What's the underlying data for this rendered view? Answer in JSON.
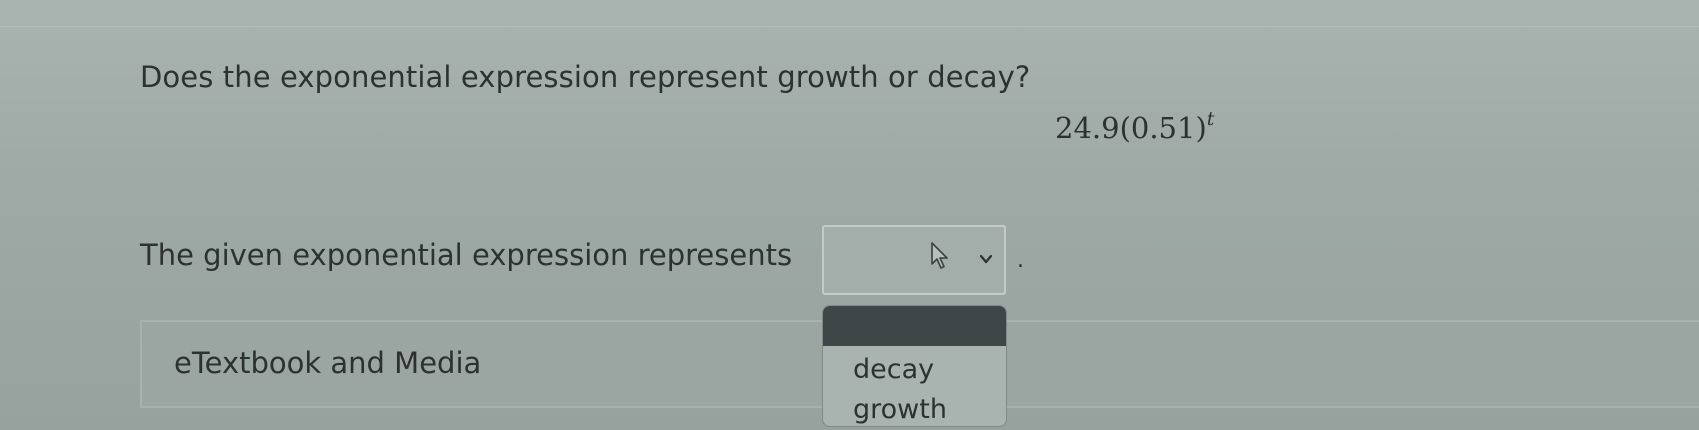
{
  "question": {
    "text": "Does the exponential expression represent growth or decay?",
    "expression_base": "24.9(0.51)",
    "expression_exponent": "t"
  },
  "answer": {
    "prefix": "The given exponential expression represents",
    "suffix": "."
  },
  "dropdown": {
    "options": [
      "decay",
      "growth"
    ]
  },
  "resources": {
    "label": "eTextbook and Media"
  },
  "icons": {
    "select_arrow": "chevron-down-icon",
    "pointer": "mouse-cursor-icon"
  }
}
